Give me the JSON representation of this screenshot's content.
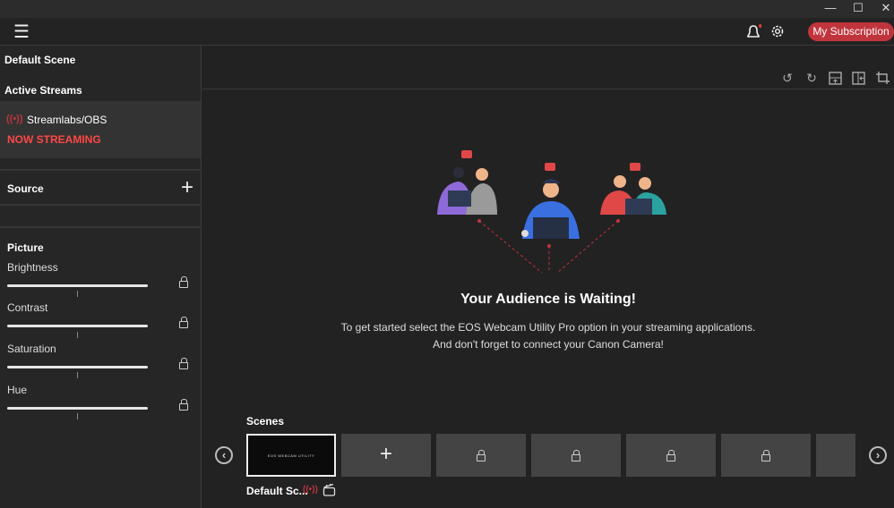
{
  "window": {
    "minimize": "—",
    "maximize": "☐",
    "close": "✕"
  },
  "header": {
    "menu_icon": "☰",
    "subscription": "My Subscription"
  },
  "sidebar": {
    "default_scene": "Default Scene",
    "active_streams": "Active Streams",
    "stream_name": "Streamlabs/OBS",
    "stream_status": "NOW STREAMING",
    "source": "Source",
    "add": "+",
    "picture": "Picture",
    "controls": [
      {
        "label": "Brightness"
      },
      {
        "label": "Contrast"
      },
      {
        "label": "Saturation"
      },
      {
        "label": "Hue"
      }
    ]
  },
  "main": {
    "heading": "Your Audience is Waiting!",
    "line1": "To get started select the EOS Webcam Utility Pro option in your streaming applications.",
    "line2": "And don't forget to connect your Canon Camera!"
  },
  "scenes": {
    "label": "Scenes",
    "thumb_text": "EOS WEBCAM UTILITY",
    "scene_name": "Default Sc...",
    "add": "+",
    "prev": "‹",
    "next": "›"
  },
  "colors": {
    "accent": "#c0353c",
    "streaming": "#ff4646"
  }
}
